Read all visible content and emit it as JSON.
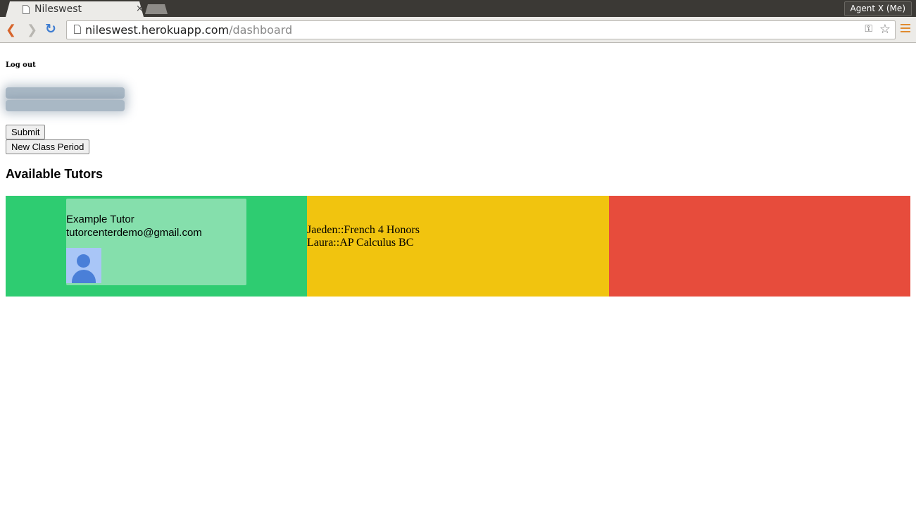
{
  "browser": {
    "tab_title": "Nileswest",
    "tab_close": "×",
    "profile": "Agent X (Me)",
    "url_host": "nileswest.herokuapp.com",
    "url_path": "/dashboard"
  },
  "page": {
    "logout": "Log out",
    "submit_label": "Submit",
    "new_class_label": "New Class Period",
    "section_title": "Available Tutors",
    "tutor": {
      "name": "Example Tutor",
      "email": "tutorcenterdemo@gmail.com"
    },
    "queue": [
      "Jaeden::French 4 Honors",
      "Laura::AP Calculus BC"
    ]
  },
  "colors": {
    "available": "#2ecc71",
    "waiting": "#f1c40f",
    "busy": "#e74c3c",
    "card": "#85dfac"
  },
  "icons": {
    "tab": "page-icon",
    "back": "back-arrow-icon",
    "forward": "forward-arrow-icon",
    "reload": "reload-icon",
    "key": "key-icon",
    "star": "star-icon",
    "menu": "menu-icon",
    "avatar": "user-avatar-icon"
  }
}
